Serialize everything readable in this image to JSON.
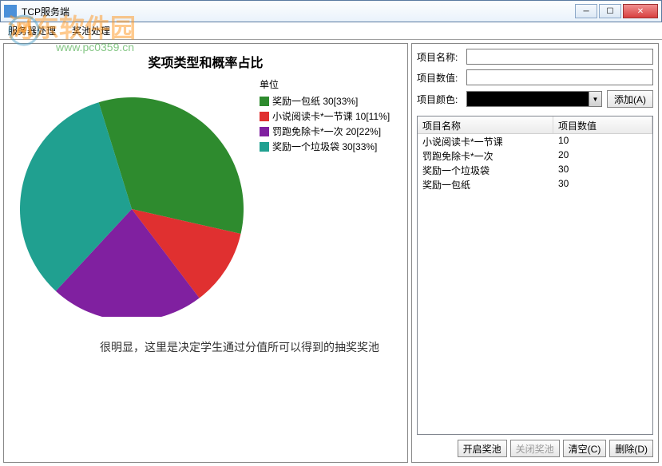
{
  "window": {
    "title": "TCP服务端"
  },
  "menubar": {
    "item1": "服务器处理",
    "item2": "奖池处理"
  },
  "watermark": {
    "text1": "河东软件园",
    "text2": "www.pc0359.cn"
  },
  "chart_data": {
    "type": "pie",
    "title": "奖项类型和概率占比",
    "legend_title": "单位",
    "series": [
      {
        "name": "奖励一包纸",
        "value": 30,
        "percent": 33,
        "color": "#2e8b2e",
        "label": "奖励一包纸 30[33%]"
      },
      {
        "name": "小说阅读卡*一节课",
        "value": 10,
        "percent": 11,
        "color": "#e03030",
        "label": "小说阅读卡*一节课 10[11%]"
      },
      {
        "name": "罚跑免除卡*一次",
        "value": 20,
        "percent": 22,
        "color": "#8020a0",
        "label": "罚跑免除卡*一次 20[22%]"
      },
      {
        "name": "奖励一个垃圾袋",
        "value": 30,
        "percent": 33,
        "color": "#20a090",
        "label": "奖励一个垃圾袋 30[33%]"
      }
    ]
  },
  "annotation": "很明显，这里是决定学生通过分值所可以得到的抽奖奖池",
  "form": {
    "name_label": "项目名称:",
    "value_label": "项目数值:",
    "color_label": "项目颜色:",
    "selected_color": "#000000",
    "add_button": "添加(A)"
  },
  "list": {
    "header_name": "项目名称",
    "header_value": "项目数值",
    "rows": [
      {
        "name": "小说阅读卡*一节课",
        "value": "10"
      },
      {
        "name": "罚跑免除卡*一次",
        "value": "20"
      },
      {
        "name": "奖励一个垃圾袋",
        "value": "30"
      },
      {
        "name": "奖励一包纸",
        "value": "30"
      }
    ]
  },
  "buttons": {
    "open": "开启奖池",
    "close": "关闭奖池",
    "clear": "清空(C)",
    "delete": "删除(D)"
  }
}
